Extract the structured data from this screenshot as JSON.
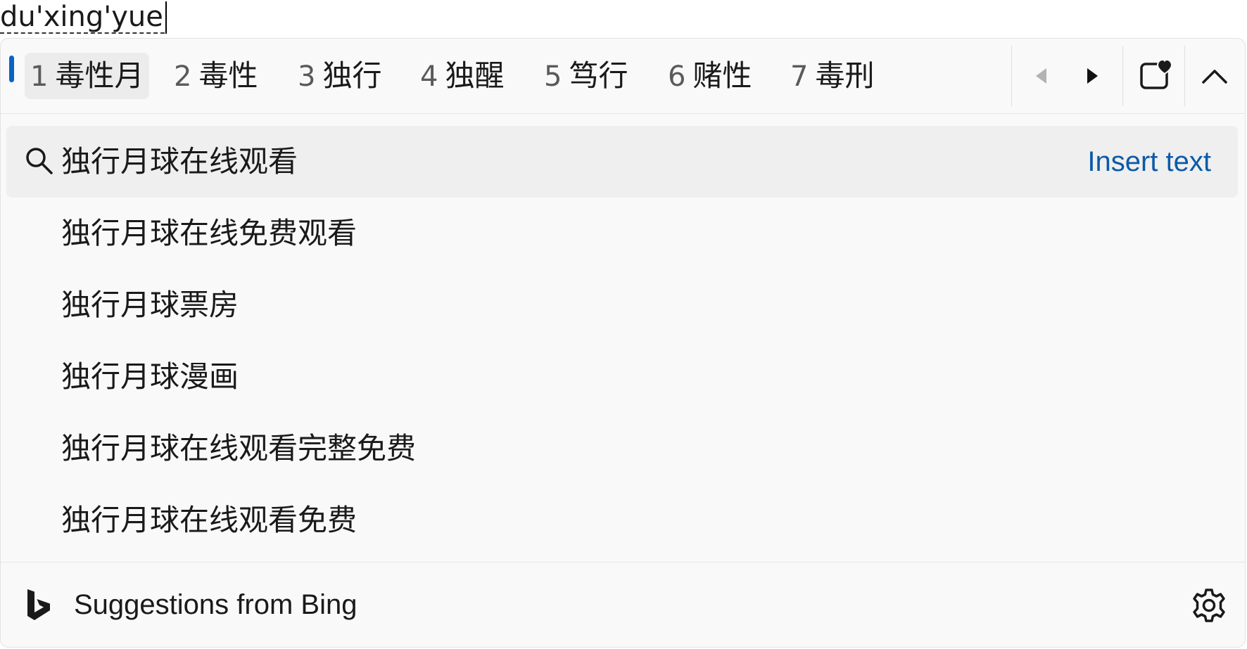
{
  "composition": {
    "text": "du'xing'yue"
  },
  "candidates": [
    {
      "num": "1",
      "text": "毒性月",
      "selected": true
    },
    {
      "num": "2",
      "text": "毒性"
    },
    {
      "num": "3",
      "text": "独行"
    },
    {
      "num": "4",
      "text": "独醒"
    },
    {
      "num": "5",
      "text": "笃行"
    },
    {
      "num": "6",
      "text": "赌性"
    },
    {
      "num": "7",
      "text": "毒刑"
    }
  ],
  "toolbar_icons": {
    "prev": "triangle-left-icon",
    "next": "triangle-right-icon",
    "favorites": "calendar-heart-icon",
    "collapse": "chevron-up-icon"
  },
  "suggestions": [
    {
      "text": "独行月球在线观看",
      "active": true,
      "icon": "search-icon",
      "action": "Insert text"
    },
    {
      "text": "独行月球在线免费观看"
    },
    {
      "text": "独行月球票房"
    },
    {
      "text": "独行月球漫画"
    },
    {
      "text": "独行月球在线观看完整免费"
    },
    {
      "text": "独行月球在线观看免费"
    }
  ],
  "footer": {
    "label": "Suggestions from Bing",
    "logo_icon": "bing-logo-icon",
    "settings_icon": "gear-icon"
  },
  "colors": {
    "accent": "#0a63c2",
    "link": "#0b5aa8",
    "panel_bg": "#f9f9f9",
    "selected_bg": "#ececec"
  }
}
